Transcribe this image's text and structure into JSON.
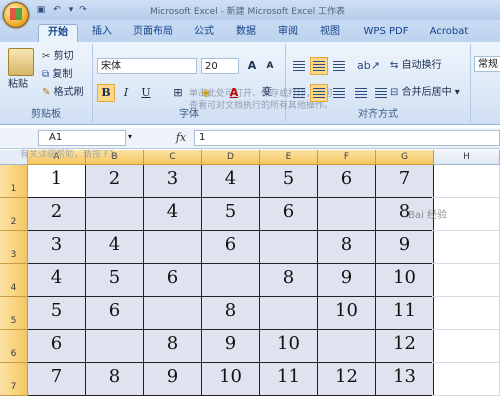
{
  "window": {
    "title": "Microsoft Excel - 新建 Microsoft Excel 工作表"
  },
  "tabs": [
    {
      "label": "开始"
    },
    {
      "label": "插入"
    },
    {
      "label": "页面布局"
    },
    {
      "label": "公式"
    },
    {
      "label": "数据"
    },
    {
      "label": "审阅"
    },
    {
      "label": "视图"
    },
    {
      "label": "WPS PDF"
    },
    {
      "label": "Acrobat"
    }
  ],
  "ribbon": {
    "clipboard": {
      "paste": "粘贴",
      "cut": "剪切",
      "copy": "复制",
      "format_painter": "格式刷",
      "label": "剪贴板"
    },
    "font": {
      "name": "宋体",
      "size": "20",
      "grow": "A",
      "shrink": "A",
      "bold": "B",
      "italic": "I",
      "underline": "U",
      "phonetic": "变",
      "label": "字体",
      "tooltip": "单击此处可打开、保存或打印，并可查看可对文档执行的所有其他操作。"
    },
    "alignment": {
      "wrap": "自动换行",
      "merge": "合并后居中",
      "label": "对齐方式"
    },
    "number": {
      "format": "常规"
    }
  },
  "formula_bar": {
    "name_box": "A1",
    "fx": "fx",
    "value": "1"
  },
  "hint_bar": {
    "text": "有关详细帮助，请按 F1。"
  },
  "sheet": {
    "columns": [
      "A",
      "B",
      "C",
      "D",
      "E",
      "F",
      "G",
      "H"
    ],
    "rows": [
      "1",
      "2",
      "3",
      "4",
      "5",
      "6",
      "7"
    ],
    "cells": [
      [
        "1",
        "2",
        "3",
        "4",
        "5",
        "6",
        "7"
      ],
      [
        "2",
        "",
        "4",
        "5",
        "6",
        "",
        "8"
      ],
      [
        "3",
        "4",
        "",
        "6",
        "",
        "8",
        "9"
      ],
      [
        "4",
        "5",
        "6",
        "",
        "8",
        "9",
        "10"
      ],
      [
        "5",
        "6",
        "",
        "8",
        "",
        "10",
        "11"
      ],
      [
        "6",
        "",
        "8",
        "9",
        "10",
        "",
        "12"
      ],
      [
        "7",
        "8",
        "9",
        "10",
        "11",
        "12",
        "13"
      ]
    ]
  },
  "watermark": "Bai 经验"
}
